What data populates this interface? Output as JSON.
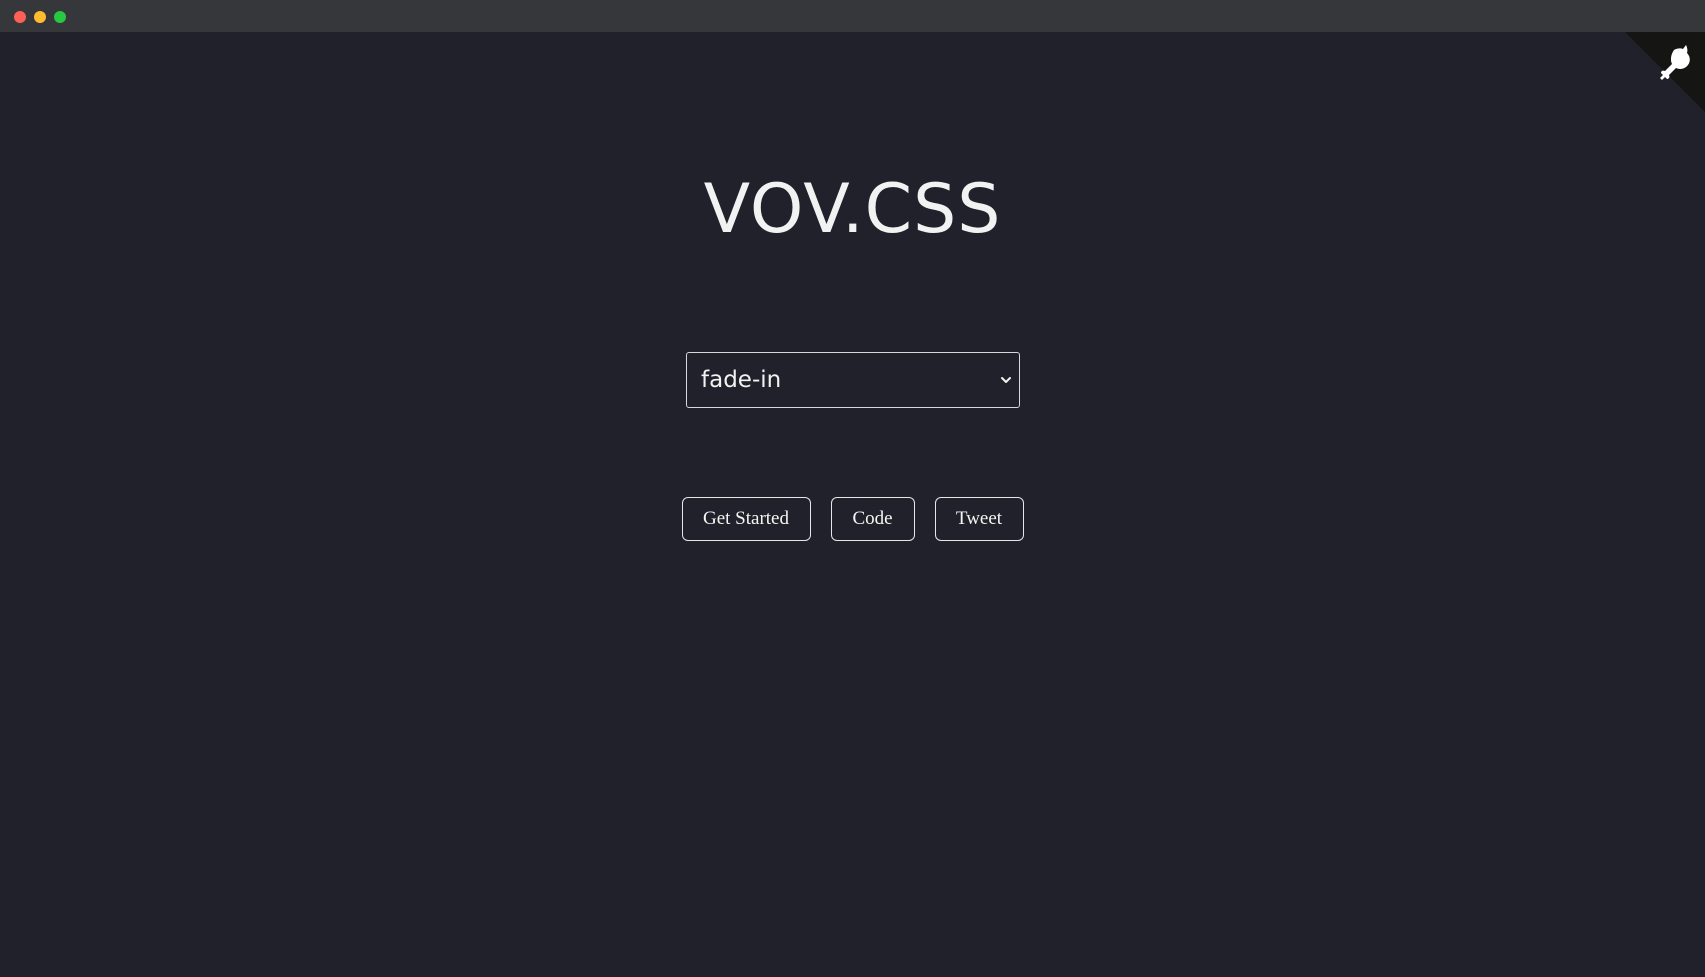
{
  "window": {
    "controls": [
      "close",
      "minimize",
      "maximize"
    ]
  },
  "header": {
    "title": "VOV.CSS"
  },
  "animation_select": {
    "selected": "fade-in"
  },
  "actions": {
    "get_started_label": "Get Started",
    "code_label": "Code",
    "tweet_label": "Tweet"
  },
  "corner": {
    "icon": "github-octocat-icon"
  },
  "colors": {
    "background": "#20212a",
    "titlebar": "#36373a",
    "text": "#f2f2f2",
    "close": "#fe5f57",
    "minimize": "#febc2e",
    "maximize": "#28c840"
  }
}
